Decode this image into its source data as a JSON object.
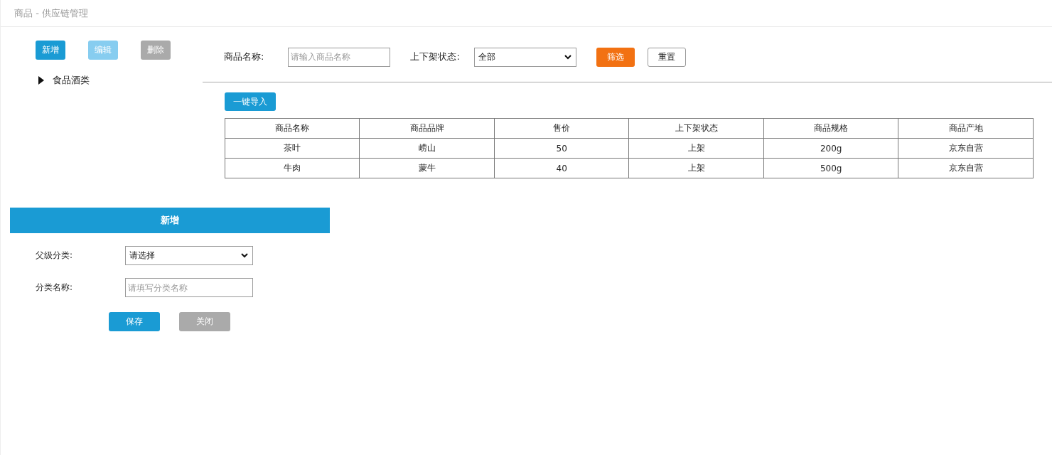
{
  "header": {
    "title": "商品 - 供应链管理"
  },
  "toolbar": [
    {
      "label": "新增",
      "kind": "primary"
    },
    {
      "label": "编辑",
      "kind": "light"
    },
    {
      "label": "删除",
      "kind": "gray"
    }
  ],
  "tree": [
    {
      "label": "食品酒类",
      "expanded": false
    }
  ],
  "filter": {
    "name_label": "商品名称:",
    "name_placeholder": "请输入商品名称",
    "status_label": "上下架状态:",
    "status_value": "全部",
    "filter_button": "筛选",
    "reset_button": "重置"
  },
  "import_button": "一键导入",
  "table": {
    "columns": [
      "商品名称",
      "商品品牌",
      "售价",
      "上下架状态",
      "商品规格",
      "商品产地"
    ],
    "rows": [
      [
        "茶叶",
        "崂山",
        "50",
        "上架",
        "200g",
        "京东自营"
      ],
      [
        "牛肉",
        "蒙牛",
        "40",
        "上架",
        "500g",
        "京东自营"
      ]
    ]
  },
  "form": {
    "title": "新增",
    "parent_label": "父级分类:",
    "parent_value": "请选择",
    "name_label": "分类名称:",
    "name_placeholder": "请填写分类名称",
    "save_button": "保存",
    "close_button": "关闭"
  }
}
